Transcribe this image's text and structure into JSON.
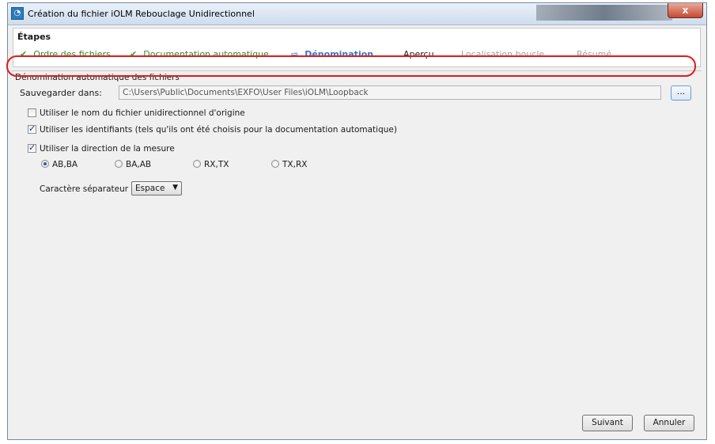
{
  "window": {
    "title": "Création du fichier iOLM Rebouclage Unidirectionnel",
    "close_label": "x"
  },
  "steps": {
    "title": "Étapes",
    "items": [
      {
        "label": "Ordre des fichiers",
        "state": "done",
        "icon": "checkmark-icon"
      },
      {
        "label": "Documentation automatique",
        "state": "done",
        "icon": "checkmark-icon"
      },
      {
        "label": "Dénomination",
        "state": "active",
        "icon": "arrow-right-icon"
      },
      {
        "label": "Aperçu",
        "state": "pending"
      },
      {
        "label": "Localisation boucle",
        "state": "disabled"
      },
      {
        "label": "Résumé",
        "state": "disabled"
      }
    ]
  },
  "naming": {
    "section_label": "Dénomination automatique des fichiers",
    "save_label": "Sauvegarder dans:",
    "save_path": "C:\\Users\\Public\\Documents\\EXFO\\User Files\\iOLM\\Loopback",
    "browse_label": "...",
    "options": [
      {
        "label": "Utiliser le nom du fichier unidirectionnel d'origine",
        "checked": false
      },
      {
        "label": "Utiliser les identifiants (tels qu'ils ont été choisis pour la documentation automatique)",
        "checked": true
      },
      {
        "label": "Utiliser la direction de la mesure",
        "checked": true
      }
    ],
    "directions": [
      {
        "label": "AB,BA",
        "selected": true
      },
      {
        "label": "BA,AB",
        "selected": false
      },
      {
        "label": "RX,TX",
        "selected": false
      },
      {
        "label": "TX,RX",
        "selected": false
      }
    ],
    "separator_label": "Caractère séparateur :",
    "separator_value": "Espace"
  },
  "footer": {
    "next_label": "Suivant",
    "cancel_label": "Annuler"
  },
  "colors": {
    "done": "#2f8a2f",
    "active": "#3a72c8",
    "highlight": "#dd1c1c"
  }
}
